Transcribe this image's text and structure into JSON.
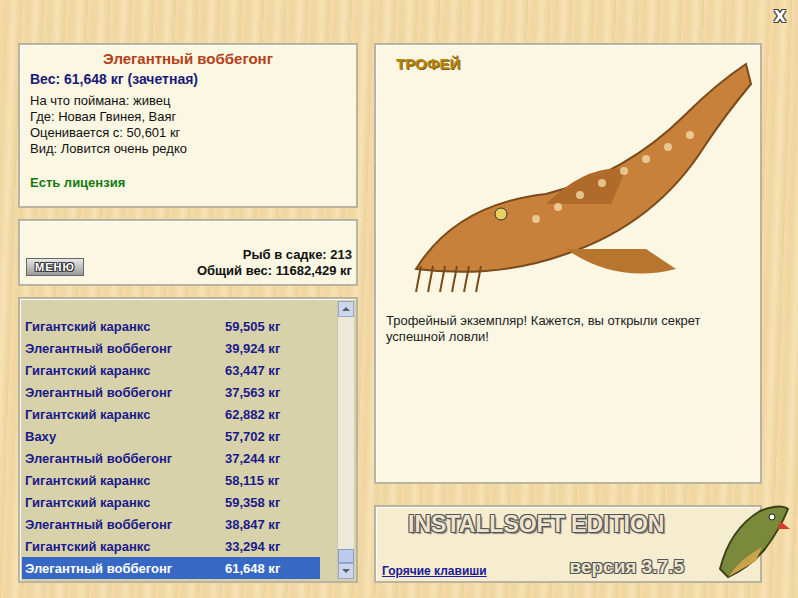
{
  "window": {
    "close": "X"
  },
  "fish_info": {
    "name": "Элегантный воббегонг",
    "weight": "Вес: 61,648 кг (зачетная)",
    "details": [
      "На что поймана: живец",
      "Где: Новая Гвинея, Ваяг",
      "Оценивается с: 50,601 кг",
      "Вид: Ловится очень редко"
    ],
    "license": "Есть лицензия"
  },
  "menu_button": "МЕНЮ",
  "stats": [
    "Рыб в садке: 213",
    "Общий вес: 11682,429 кг"
  ],
  "catch_list": {
    "scroll_level": 1,
    "rows": [
      {
        "name": "Гигантский каранкс",
        "weight": "59,505 кг",
        "selected": false
      },
      {
        "name": "Элегантный воббегонг",
        "weight": "39,924 кг",
        "selected": false
      },
      {
        "name": "Гигантский каранкс",
        "weight": "63,447 кг",
        "selected": false
      },
      {
        "name": "Элегантный воббегонг",
        "weight": "37,563 кг",
        "selected": false
      },
      {
        "name": "Гигантский каранкс",
        "weight": "62,882 кг",
        "selected": false
      },
      {
        "name": "Ваху",
        "weight": "57,702 кг",
        "selected": false
      },
      {
        "name": "Элегантный воббегонг",
        "weight": "37,244 кг",
        "selected": false
      },
      {
        "name": "Гигантский каранкс",
        "weight": "58,115 кг",
        "selected": false
      },
      {
        "name": "Гигантский каранкс",
        "weight": "59,358 кг",
        "selected": false
      },
      {
        "name": "Элегантный воббегонг",
        "weight": "38,847 кг",
        "selected": false
      },
      {
        "name": "Гигантский каранкс",
        "weight": "33,294 кг",
        "selected": false
      },
      {
        "name": "Элегантный воббегонг",
        "weight": "61,648 кг",
        "selected": true
      }
    ]
  },
  "trophy": {
    "badge": "ТРОФЕЙ",
    "message": "Трофейный экземпляр! Кажется, вы открыли секрет успешной ловли!"
  },
  "footer": {
    "edition": "INSTALLSOFT EDITION",
    "hotkeys": "Горячие клавиши",
    "version": "версия 3.7.5"
  }
}
